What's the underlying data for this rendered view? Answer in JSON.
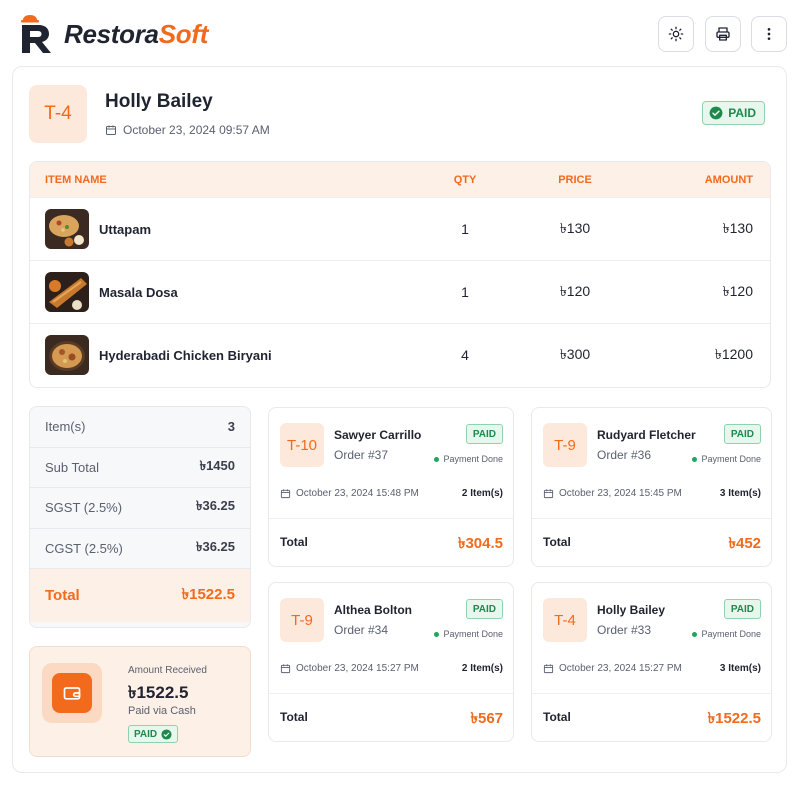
{
  "brand": {
    "part1": "Restora",
    "part2": "Soft",
    "accent": "#f26a1b"
  },
  "toolbar": {
    "theme_icon": "sun-icon",
    "print_icon": "printer-icon",
    "more_icon": "more-vertical-icon"
  },
  "order": {
    "table": "T-4",
    "customer": "Holly Bailey",
    "datetime": "October 23, 2024 09:57 AM",
    "status": "PAID"
  },
  "items_table": {
    "headers": {
      "name": "ITEM NAME",
      "qty": "QTY",
      "price": "PRICE",
      "amount": "AMOUNT"
    },
    "rows": [
      {
        "name": "Uttapam",
        "qty": "1",
        "price": "৳130",
        "amount": "৳130"
      },
      {
        "name": "Masala Dosa",
        "qty": "1",
        "price": "৳120",
        "amount": "৳120"
      },
      {
        "name": "Hyderabadi Chicken Biryani",
        "qty": "4",
        "price": "৳300",
        "amount": "৳1200"
      }
    ]
  },
  "summary": {
    "items_label": "Item(s)",
    "items_value": "3",
    "subtotal_label": "Sub Total",
    "subtotal_value": "৳1450",
    "sgst_label": "SGST (2.5%)",
    "sgst_value": "৳36.25",
    "cgst_label": "CGST (2.5%)",
    "cgst_value": "৳36.25",
    "total_label": "Total",
    "total_value": "৳1522.5"
  },
  "received": {
    "label": "Amount Received",
    "amount": "৳1522.5",
    "method": "Paid via Cash",
    "status": "PAID"
  },
  "orders": [
    {
      "table": "T-10",
      "name": "Sawyer Carrillo",
      "order_no": "Order #37",
      "status": "PAID",
      "payment": "Payment Done",
      "datetime": "October 23, 2024 15:48 PM",
      "items": "2 Item(s)",
      "total_label": "Total",
      "total": "৳304.5"
    },
    {
      "table": "T-9",
      "name": "Rudyard Fletcher",
      "order_no": "Order #36",
      "status": "PAID",
      "payment": "Payment Done",
      "datetime": "October 23, 2024 15:45 PM",
      "items": "3 Item(s)",
      "total_label": "Total",
      "total": "৳452"
    },
    {
      "table": "T-9",
      "name": "Althea Bolton",
      "order_no": "Order #34",
      "status": "PAID",
      "payment": "Payment Done",
      "datetime": "October 23, 2024 15:27 PM",
      "items": "2 Item(s)",
      "total_label": "Total",
      "total": "৳567"
    },
    {
      "table": "T-4",
      "name": "Holly Bailey",
      "order_no": "Order #33",
      "status": "PAID",
      "payment": "Payment Done",
      "datetime": "October 23, 2024 15:27 PM",
      "items": "3 Item(s)",
      "total_label": "Total",
      "total": "৳1522.5"
    }
  ]
}
